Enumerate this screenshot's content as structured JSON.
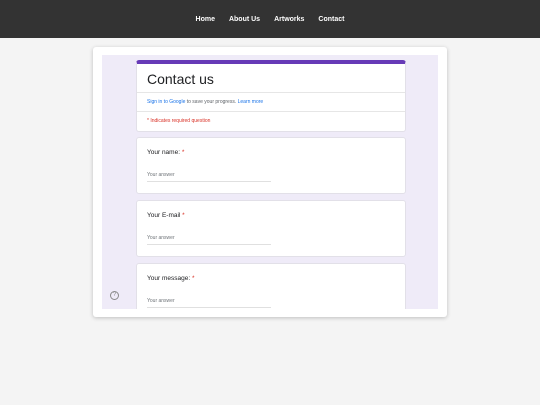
{
  "nav": {
    "items": [
      "Home",
      "About Us",
      "Artworks",
      "Contact"
    ]
  },
  "form": {
    "title": "Contact us",
    "signin_link": "Sign in to Google",
    "signin_text": " to save your progress. ",
    "learn_more": "Learn more",
    "required_note": "* Indicates required question",
    "accent_color": "#673ab7",
    "background_color": "#efebf8",
    "required_color": "#d93025",
    "questions": [
      {
        "label": "Your name: ",
        "required_mark": "*",
        "placeholder": "Your answer"
      },
      {
        "label": "Your E-mail ",
        "required_mark": "*",
        "placeholder": "Your answer"
      },
      {
        "label": "Your message: ",
        "required_mark": "*",
        "placeholder": "Your answer"
      }
    ]
  },
  "help": {
    "icon": "help-circle-icon",
    "glyph": "?"
  }
}
